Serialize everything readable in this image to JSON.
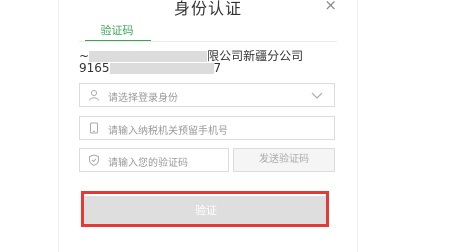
{
  "dialog": {
    "title": "身份认证",
    "close_icon": "×"
  },
  "tabs": [
    {
      "label": "验证码",
      "active": true
    }
  ],
  "company": {
    "line1_prefix": "~",
    "line1_suffix": "限公司新疆分公司",
    "line2_prefix": "9165",
    "line2_suffix": "7"
  },
  "form": {
    "identity_placeholder": "请选择登录身份",
    "phone_placeholder": "请输入纳税机关预留手机号",
    "code_placeholder": "请输入您的验证码",
    "send_code_label": "发送验证码",
    "submit_label": "验证"
  },
  "colors": {
    "accent": "#3aa655",
    "highlight": "#e53935"
  },
  "icons": {
    "identity": "user-icon",
    "phone": "phone-icon",
    "code": "shield-check-icon",
    "dropdown": "chevron-down-icon"
  }
}
